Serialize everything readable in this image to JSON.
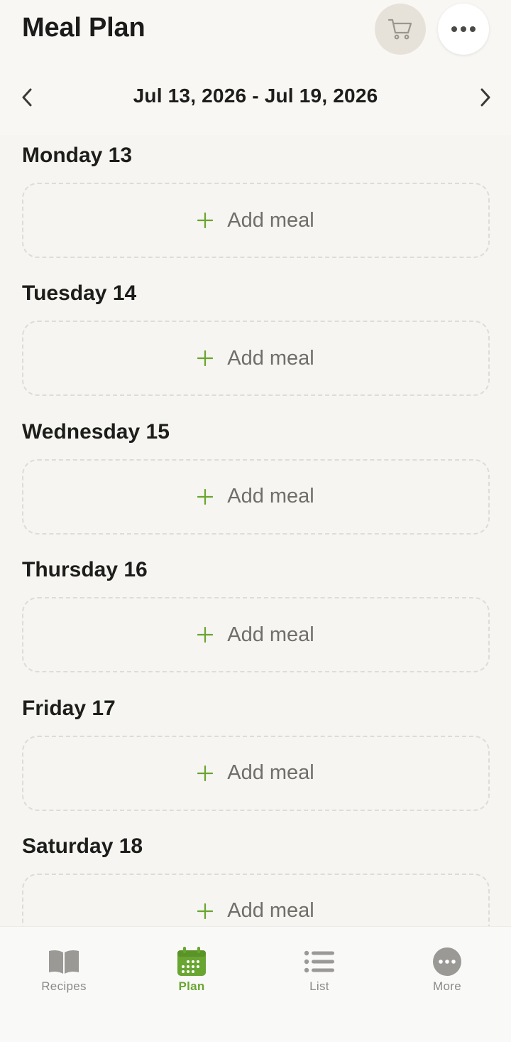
{
  "header": {
    "title": "Meal Plan",
    "cart_icon": "shopping-cart-icon",
    "more_icon": "ellipsis-icon"
  },
  "week": {
    "range": "Jul 13, 2026 - Jul 19, 2026",
    "prev_icon": "chevron-left-icon",
    "next_icon": "chevron-right-icon"
  },
  "days": [
    {
      "title": "Monday 13",
      "add_label": "Add meal"
    },
    {
      "title": "Tuesday 14",
      "add_label": "Add meal"
    },
    {
      "title": "Wednesday 15",
      "add_label": "Add meal"
    },
    {
      "title": "Thursday 16",
      "add_label": "Add meal"
    },
    {
      "title": "Friday 17",
      "add_label": "Add meal"
    },
    {
      "title": "Saturday 18",
      "add_label": "Add meal"
    }
  ],
  "tabs": [
    {
      "label": "Recipes",
      "icon": "book-icon",
      "active": false
    },
    {
      "label": "Plan",
      "icon": "calendar-icon",
      "active": true
    },
    {
      "label": "List",
      "icon": "list-icon",
      "active": false
    },
    {
      "label": "More",
      "icon": "more-circle-icon",
      "active": false
    }
  ],
  "colors": {
    "accent": "#69a531",
    "background": "#f6f5f1",
    "inactive_tab": "#8b8a86",
    "dashed_border": "#dedcd7"
  }
}
